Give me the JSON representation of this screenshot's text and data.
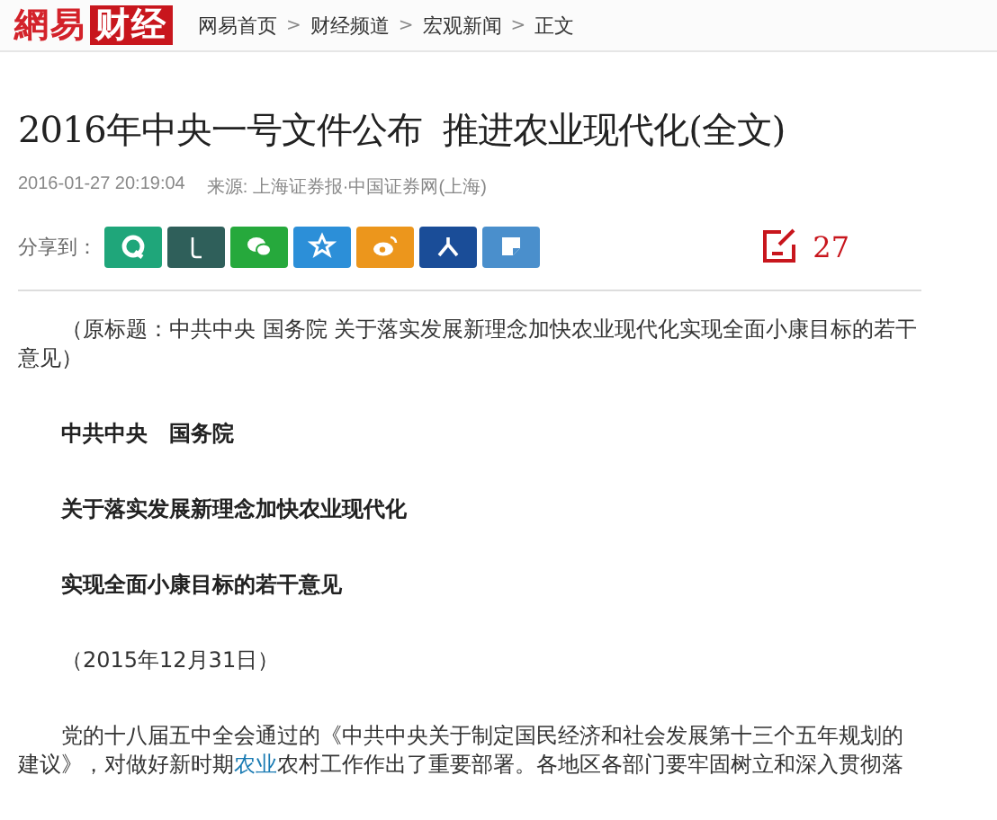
{
  "header": {
    "logo": {
      "brand": "網易",
      "channel": "财经"
    },
    "breadcrumb": [
      "网易首页",
      "财经频道",
      "宏观新闻",
      "正文"
    ],
    "separator": ">"
  },
  "article": {
    "title": "2016年中央一号文件公布  推进农业现代化(全文)",
    "time": "2016-01-27 20:19:04",
    "source": "来源: 上海证券报·中国证券网(上海)",
    "share": {
      "label": "分享到：",
      "buttons": [
        {
          "kind": "qzone",
          "color": "#1fa67a"
        },
        {
          "kind": "phone",
          "color": "#2f5f5a"
        },
        {
          "kind": "wechat",
          "color": "#26a93c"
        },
        {
          "kind": "star",
          "color": "#2c8fd8"
        },
        {
          "kind": "weibo",
          "color": "#ec961c"
        },
        {
          "kind": "person",
          "color": "#1a4d98"
        },
        {
          "kind": "note",
          "color": "#4a8fcc"
        }
      ]
    },
    "comments": {
      "count": "27"
    },
    "paragraphs": [
      {
        "kind": "text",
        "parts": [
          {
            "text": "（原标题：中共中央  国务院 关于落实发展新理念加快农业现代化实现全面小康目标的若干意见）"
          }
        ]
      },
      {
        "kind": "heading",
        "parts": [
          {
            "text": "中共中央　国务院"
          }
        ]
      },
      {
        "kind": "heading",
        "parts": [
          {
            "text": "关于落实发展新理念加快农业现代化"
          }
        ]
      },
      {
        "kind": "heading",
        "parts": [
          {
            "text": "实现全面小康目标的若干意见"
          }
        ]
      },
      {
        "kind": "text",
        "parts": [
          {
            "text": "（2015年12月31日）"
          }
        ]
      },
      {
        "kind": "text",
        "parts": [
          {
            "text": "党的十八届五中全会通过的《中共中央关于制定国民经济和社会发展第十三个五年规划的建议》，对做好新时期"
          },
          {
            "text": "农业",
            "kind": "link"
          },
          {
            "text": "农村工作作出了重要部署。各地区各部门要牢固树立和深入贯彻落"
          }
        ]
      }
    ]
  }
}
